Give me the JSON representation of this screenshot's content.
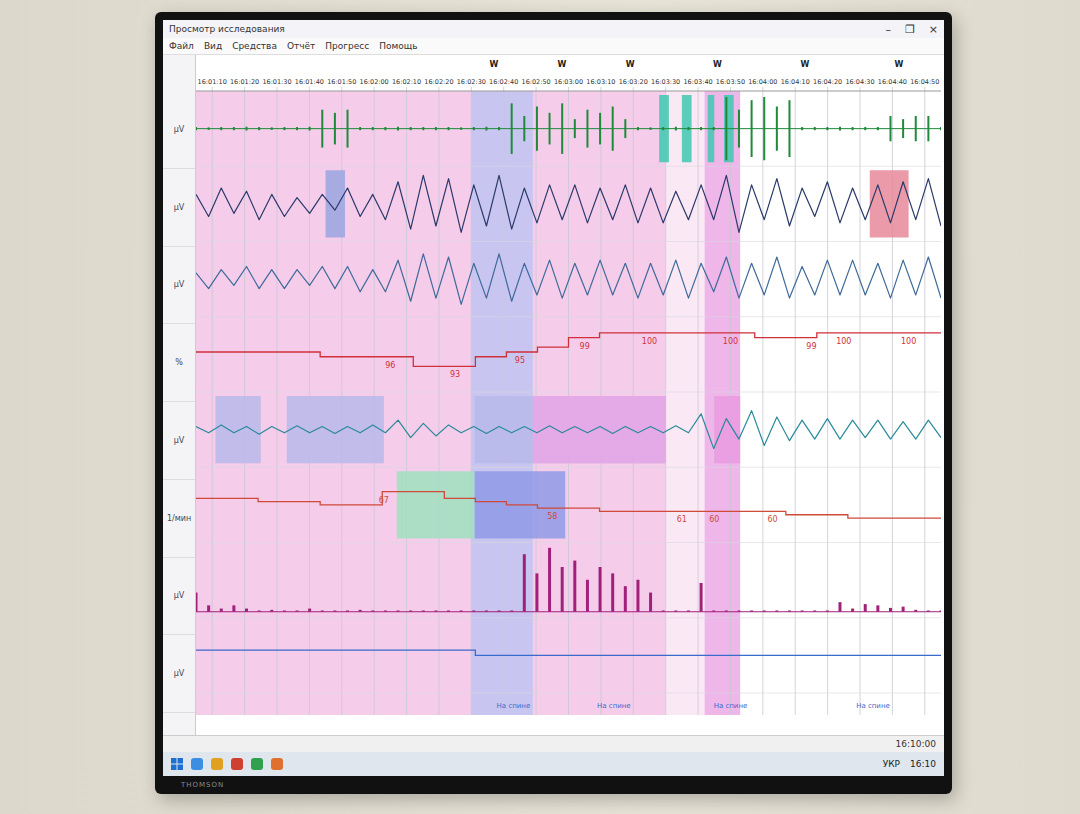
{
  "window": {
    "title": "Просмотр исследования",
    "controls": [
      "–",
      "❐",
      "×"
    ]
  },
  "menu": [
    "Файл",
    "Вид",
    "Средства",
    "Отчёт",
    "Прогресс",
    "Помощь"
  ],
  "axis": {
    "start": 0,
    "end": 230
  },
  "ticks": [
    {
      "t": 5,
      "label": "16:01:10"
    },
    {
      "t": 15,
      "label": "16:01:20"
    },
    {
      "t": 25,
      "label": "16:01:30"
    },
    {
      "t": 35,
      "label": "16:01:40"
    },
    {
      "t": 45,
      "label": "16:01:50"
    },
    {
      "t": 55,
      "label": "16:02:00"
    },
    {
      "t": 65,
      "label": "16:02:10"
    },
    {
      "t": 75,
      "label": "16:02:20"
    },
    {
      "t": 85,
      "label": "16:02:30"
    },
    {
      "t": 95,
      "label": "16:02:40"
    },
    {
      "t": 105,
      "label": "16:02:50"
    },
    {
      "t": 115,
      "label": "16:03:00"
    },
    {
      "t": 125,
      "label": "16:03:10"
    },
    {
      "t": 135,
      "label": "16:03:20"
    },
    {
      "t": 145,
      "label": "16:03:30"
    },
    {
      "t": 155,
      "label": "16:03:40"
    },
    {
      "t": 165,
      "label": "16:03:50"
    },
    {
      "t": 175,
      "label": "16:04:00"
    },
    {
      "t": 185,
      "label": "16:04:10"
    },
    {
      "t": 195,
      "label": "16:04:20"
    },
    {
      "t": 205,
      "label": "16:04:30"
    },
    {
      "t": 215,
      "label": "16:04:40"
    },
    {
      "t": 225,
      "label": "16:04:50"
    }
  ],
  "stages": [
    {
      "t": 92,
      "label": "W"
    },
    {
      "t": 113,
      "label": "W"
    },
    {
      "t": 134,
      "label": "W"
    },
    {
      "t": 161,
      "label": "W"
    },
    {
      "t": 188,
      "label": "W"
    },
    {
      "t": 217,
      "label": "W"
    }
  ],
  "bands": [
    {
      "start": 0,
      "end": 145,
      "color": "#f5cdea"
    },
    {
      "start": 145,
      "end": 157,
      "color": "#fbe8f5"
    },
    {
      "start": 85,
      "end": 104,
      "color": "#c8c6f0"
    },
    {
      "start": 157,
      "end": 168,
      "color": "#efb6ea"
    }
  ],
  "channels": [
    {
      "name": "µV",
      "kind": "spikes",
      "color": "#1f8a3a",
      "min": 0,
      "max": 1,
      "values": [
        0.05,
        0.04,
        0.05,
        0.05,
        0.06,
        0.05,
        0.04,
        0.05,
        0.05,
        0.06,
        0.6,
        0.5,
        0.6,
        0.05,
        0.05,
        0.05,
        0.06,
        0.05,
        0.05,
        0.05,
        0.05,
        0.04,
        0.05,
        0.06,
        0.05,
        0.8,
        0.4,
        0.7,
        0.5,
        0.8,
        0.3,
        0.6,
        0.5,
        0.7,
        0.3,
        0.05,
        0.04,
        0.05,
        0.06,
        0.05,
        0.05,
        0.05,
        1.0,
        0.6,
        0.9,
        1.0,
        0.7,
        0.9,
        0.05,
        0.05,
        0.05,
        0.06,
        0.05,
        0.05,
        0.05,
        0.4,
        0.3,
        0.4,
        0.4,
        0.05
      ],
      "marks": [
        {
          "start": 143,
          "end": 146,
          "color": "#40c8b0"
        },
        {
          "start": 150,
          "end": 153,
          "color": "#40c8b0"
        },
        {
          "start": 158,
          "end": 160,
          "color": "#40c8b0"
        },
        {
          "start": 163,
          "end": 166,
          "color": "#40c8b0"
        }
      ],
      "labels": []
    },
    {
      "name": "µV",
      "kind": "wave",
      "color": "#2a3a6a",
      "min": -1,
      "max": 1,
      "values": [
        0.3,
        -0.4,
        0.5,
        -0.3,
        0.4,
        -0.5,
        0.3,
        -0.4,
        0.2,
        -0.3,
        0.3,
        -0.2,
        0.5,
        -0.4,
        0.3,
        -0.5,
        0.7,
        -0.8,
        0.9,
        -0.7,
        0.8,
        -0.9,
        0.6,
        -0.7,
        0.9,
        -0.8,
        0.5,
        -0.6,
        0.6,
        -0.5,
        0.6,
        -0.6,
        0.5,
        -0.5,
        0.6,
        -0.6,
        0.5,
        -0.6,
        0.4,
        -0.5,
        0.6,
        -0.5,
        0.9,
        -0.9,
        0.6,
        -0.5,
        0.8,
        -0.7,
        0.5,
        -0.4,
        0.7,
        -0.6,
        0.5,
        -0.5,
        0.6,
        -0.6,
        0.7,
        -0.5,
        0.8,
        -0.7
      ],
      "marks": [
        {
          "start": 40,
          "end": 46,
          "color": "#9aa4e0"
        },
        {
          "start": 208,
          "end": 220,
          "color": "#e8889a"
        }
      ],
      "labels": []
    },
    {
      "name": "µV",
      "kind": "wave",
      "color": "#3f6a9a",
      "min": -1,
      "max": 1,
      "values": [
        0.2,
        -0.3,
        0.3,
        -0.2,
        0.4,
        -0.3,
        0.3,
        -0.3,
        0.3,
        -0.2,
        0.4,
        -0.3,
        0.4,
        -0.4,
        0.3,
        -0.4,
        0.6,
        -0.7,
        0.8,
        -0.6,
        0.7,
        -0.8,
        0.5,
        -0.6,
        0.8,
        -0.7,
        0.5,
        -0.5,
        0.6,
        -0.6,
        0.5,
        -0.5,
        0.6,
        -0.5,
        0.5,
        -0.6,
        0.5,
        -0.5,
        0.6,
        -0.6,
        0.5,
        -0.4,
        0.7,
        -0.6,
        0.5,
        -0.5,
        0.7,
        -0.6,
        0.4,
        -0.5,
        0.6,
        -0.5,
        0.6,
        -0.5,
        0.5,
        -0.6,
        0.6,
        -0.5,
        0.7,
        -0.6
      ],
      "marks": [],
      "labels": []
    },
    {
      "name": "%",
      "kind": "level",
      "color": "#d0303a",
      "min": 90,
      "max": 101,
      "values": [
        96,
        96,
        96,
        96,
        95,
        95,
        95,
        93,
        93,
        95,
        96,
        97,
        99,
        100,
        100,
        100,
        100,
        100,
        99,
        99,
        100,
        100,
        100,
        100
      ],
      "marks": [],
      "labels": [
        {
          "t": 60,
          "text": "96"
        },
        {
          "t": 80,
          "text": "93"
        },
        {
          "t": 100,
          "text": "95"
        },
        {
          "t": 120,
          "text": "99"
        },
        {
          "t": 140,
          "text": "100"
        },
        {
          "t": 165,
          "text": "100"
        },
        {
          "t": 190,
          "text": "99"
        },
        {
          "t": 200,
          "text": "100"
        },
        {
          "t": 220,
          "text": "100"
        }
      ]
    },
    {
      "name": "µV",
      "kind": "wave",
      "color": "#2a8a9a",
      "min": -1,
      "max": 1,
      "values": [
        0.1,
        -0.1,
        0.15,
        -0.1,
        0.1,
        -0.15,
        0.1,
        -0.1,
        0.12,
        -0.1,
        0.1,
        -0.12,
        0.1,
        -0.1,
        0.15,
        -0.1,
        0.3,
        -0.25,
        0.2,
        -0.2,
        0.15,
        -0.1,
        0.1,
        -0.12,
        0.1,
        -0.1,
        0.1,
        -0.1,
        0.12,
        -0.1,
        0.1,
        -0.1,
        0.1,
        -0.12,
        0.1,
        -0.1,
        0.1,
        -0.1,
        0.12,
        -0.1,
        0.5,
        -0.6,
        0.35,
        -0.3,
        0.6,
        -0.5,
        0.4,
        -0.35,
        0.3,
        -0.3,
        0.35,
        -0.3,
        0.3,
        -0.25,
        0.3,
        -0.3,
        0.25,
        -0.3,
        0.3,
        -0.25
      ],
      "marks": [
        {
          "start": 6,
          "end": 20,
          "color": "#b9b8ea"
        },
        {
          "start": 28,
          "end": 58,
          "color": "#b9b8ea"
        },
        {
          "start": 86,
          "end": 145,
          "color": "#b9b8ea"
        },
        {
          "start": 104,
          "end": 145,
          "color": "#eaa6e6"
        },
        {
          "start": 160,
          "end": 168,
          "color": "#e79be0"
        }
      ],
      "labels": []
    },
    {
      "name": "1/мин",
      "kind": "level",
      "color": "#d04a3a",
      "min": 54,
      "max": 70,
      "values": [
        64,
        64,
        63,
        63,
        62,
        62,
        66,
        66,
        64,
        63,
        62,
        61,
        61,
        60,
        60,
        60,
        60,
        60,
        60,
        59,
        59,
        58,
        58,
        58
      ],
      "marks": [
        {
          "start": 62,
          "end": 86,
          "color": "#9fe0c0"
        },
        {
          "start": 86,
          "end": 114,
          "color": "#8f9ae6"
        }
      ],
      "labels": [
        {
          "t": 58,
          "text": "67"
        },
        {
          "t": 110,
          "text": "58"
        },
        {
          "t": 150,
          "text": "61"
        },
        {
          "t": 160,
          "text": "60"
        },
        {
          "t": 178,
          "text": "60"
        }
      ]
    },
    {
      "name": "µV",
      "kind": "bars",
      "color": "#a0207a",
      "min": 0,
      "max": 1,
      "values": [
        0.3,
        0.1,
        0.05,
        0.1,
        0.05,
        0.02,
        0.03,
        0.02,
        0.02,
        0.05,
        0.02,
        0.02,
        0.02,
        0.03,
        0.02,
        0.02,
        0.02,
        0.02,
        0.02,
        0.02,
        0.02,
        0.02,
        0.02,
        0.02,
        0.02,
        0.02,
        0.9,
        0.6,
        1.0,
        0.7,
        0.8,
        0.5,
        0.7,
        0.6,
        0.4,
        0.5,
        0.3,
        0.02,
        0.02,
        0.02,
        0.45,
        0.02,
        0.02,
        0.02,
        0.02,
        0.02,
        0.02,
        0.02,
        0.02,
        0.02,
        0.02,
        0.15,
        0.05,
        0.12,
        0.1,
        0.06,
        0.08,
        0.03,
        0.02,
        0.02
      ],
      "marks": [],
      "labels": []
    },
    {
      "name": "µV",
      "kind": "level",
      "color": "#3a6acb",
      "min": 0,
      "max": 2,
      "values": [
        1.2,
        1.2,
        1.2,
        1.2,
        1.2,
        1.2,
        1.2,
        1.2,
        1.2,
        1.0,
        1.0,
        1.0,
        1.0,
        1.0,
        1.0,
        1.0,
        1.0,
        1.0,
        1.0,
        1.0,
        1.0,
        1.0,
        1.0,
        1.0
      ],
      "marks": [],
      "labels": []
    }
  ],
  "positions": [
    {
      "t": 98,
      "label": "На спине"
    },
    {
      "t": 129,
      "label": "На спине"
    },
    {
      "t": 165,
      "label": "На спине"
    },
    {
      "t": 209,
      "label": "На спине"
    }
  ],
  "status_bar": {
    "time": "16:10:00"
  },
  "taskbar": {
    "language": "УКР",
    "clock": "16:10"
  },
  "bezel": {
    "brand": "THOMSON"
  }
}
